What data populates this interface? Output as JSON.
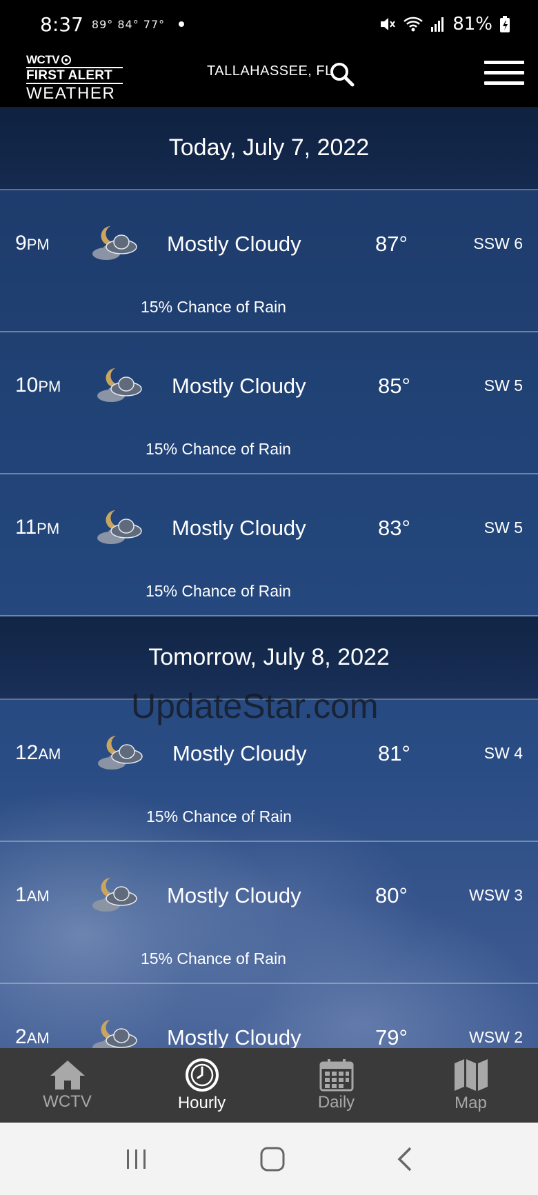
{
  "status_bar": {
    "time": "8:37",
    "temps": "89° 84° 77°",
    "battery": "81%"
  },
  "header": {
    "logo": {
      "line1": "WCTV",
      "line2": "FIRST ALERT",
      "line3": "WEATHER"
    },
    "location": "TALLAHASSEE, FL"
  },
  "days": [
    {
      "title": "Today, July 7, 2022",
      "hours": [
        {
          "hour": "9",
          "ampm": "PM",
          "condition": "Mostly Cloudy",
          "temp": "87°",
          "wind": "SSW 6",
          "rain": "15% Chance of Rain"
        },
        {
          "hour": "10",
          "ampm": "PM",
          "condition": "Mostly Cloudy",
          "temp": "85°",
          "wind": "SW 5",
          "rain": "15% Chance of Rain"
        },
        {
          "hour": "11",
          "ampm": "PM",
          "condition": "Mostly Cloudy",
          "temp": "83°",
          "wind": "SW 5",
          "rain": "15% Chance of Rain"
        }
      ]
    },
    {
      "title": "Tomorrow, July 8, 2022",
      "hours": [
        {
          "hour": "12",
          "ampm": "AM",
          "condition": "Mostly Cloudy",
          "temp": "81°",
          "wind": "SW 4",
          "rain": "15% Chance of Rain"
        },
        {
          "hour": "1",
          "ampm": "AM",
          "condition": "Mostly Cloudy",
          "temp": "80°",
          "wind": "WSW 3",
          "rain": "15% Chance of Rain"
        },
        {
          "hour": "2",
          "ampm": "AM",
          "condition": "Mostly Cloudy",
          "temp": "79°",
          "wind": "WSW 2",
          "rain": ""
        }
      ]
    }
  ],
  "watermark": "UpdateStar.com",
  "nav": {
    "items": [
      {
        "label": "WCTV",
        "icon": "home-icon"
      },
      {
        "label": "Hourly",
        "icon": "clock-icon"
      },
      {
        "label": "Daily",
        "icon": "calendar-icon"
      },
      {
        "label": "Map",
        "icon": "map-icon"
      }
    ],
    "active": "Hourly"
  },
  "icons": {
    "weather": "moon-cloud-icon"
  }
}
